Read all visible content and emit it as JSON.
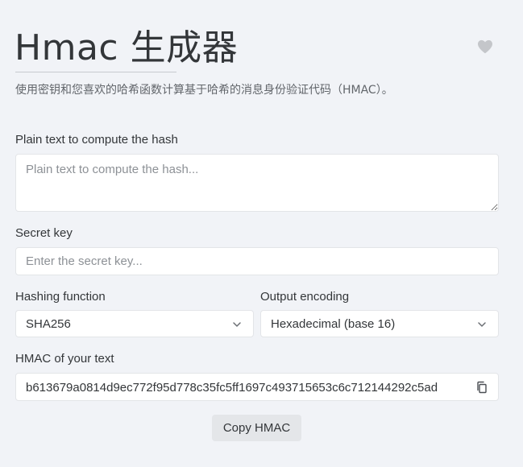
{
  "header": {
    "title": "Hmac 生成器",
    "description": "使用密钥和您喜欢的哈希函数计算基于哈希的消息身份验证代码（HMAC）。",
    "favorite_icon": "heart-icon"
  },
  "form": {
    "plain_text": {
      "label": "Plain text to compute the hash",
      "value": "",
      "placeholder": "Plain text to compute the hash..."
    },
    "secret_key": {
      "label": "Secret key",
      "value": "",
      "placeholder": "Enter the secret key..."
    },
    "hashing_function": {
      "label": "Hashing function",
      "selected": "SHA256"
    },
    "output_encoding": {
      "label": "Output encoding",
      "selected": "Hexadecimal (base 16)"
    }
  },
  "result": {
    "label": "HMAC of your text",
    "value": "b613679a0814d9ec772f95d778c35fc5ff1697c493715653c6c712144292c5ad",
    "copy_icon": "copy-icon"
  },
  "actions": {
    "copy_label": "Copy HMAC"
  },
  "colors": {
    "background": "#f1f3f7",
    "text": "#333639",
    "muted": "#62666b",
    "button_bg": "#e4e6e9",
    "heart": "#c4c6ca"
  }
}
